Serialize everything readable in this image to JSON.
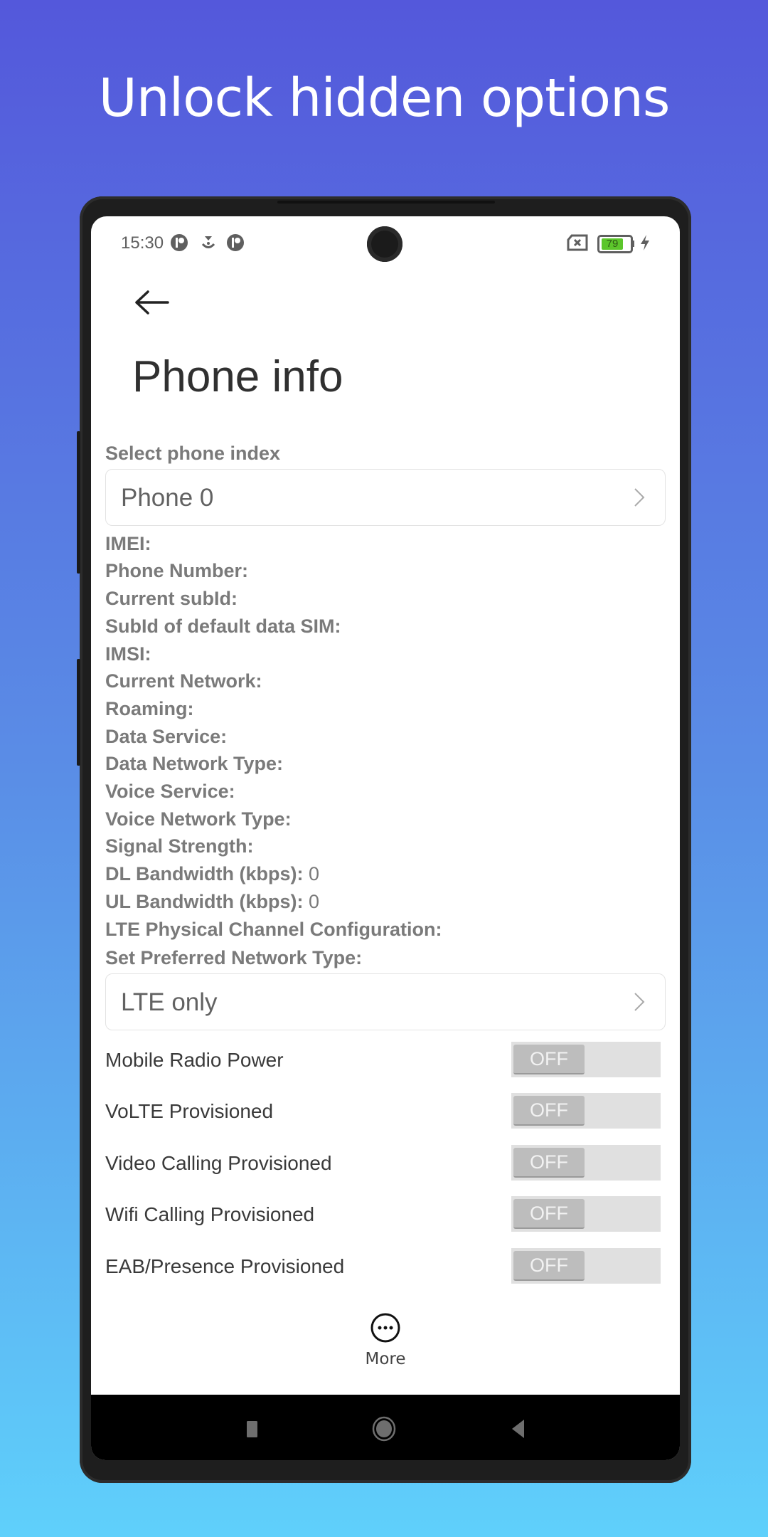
{
  "promo": {
    "headline": "Unlock hidden options"
  },
  "status_bar": {
    "time": "15:30",
    "left_icons": [
      "app-notification-icon",
      "download-icon",
      "app-notification-icon"
    ],
    "battery_level": "79",
    "battery_color": "#5cc62b",
    "right_icons": [
      "no-sim-icon",
      "battery-icon",
      "charging-icon"
    ]
  },
  "header": {
    "back": "back-arrow-icon",
    "title": "Phone info"
  },
  "phone_index": {
    "label": "Select phone index",
    "value": "Phone 0"
  },
  "info_fields": [
    {
      "label": "IMEI:",
      "value": ""
    },
    {
      "label": "Phone Number:",
      "value": ""
    },
    {
      "label": "Current subId:",
      "value": ""
    },
    {
      "label": "SubId of default data SIM:",
      "value": ""
    },
    {
      "label": "IMSI:",
      "value": ""
    },
    {
      "label": "Current Network:",
      "value": ""
    },
    {
      "label": "Roaming:",
      "value": ""
    },
    {
      "label": "Data Service:",
      "value": ""
    },
    {
      "label": "Data Network Type:",
      "value": ""
    },
    {
      "label": "Voice Service:",
      "value": ""
    },
    {
      "label": "Voice Network Type:",
      "value": ""
    },
    {
      "label": "Signal Strength:",
      "value": ""
    },
    {
      "label": "DL Bandwidth (kbps):",
      "value": "0"
    },
    {
      "label": "UL Bandwidth (kbps):",
      "value": "0"
    },
    {
      "label": "LTE Physical Channel Configuration:",
      "value": ""
    }
  ],
  "network_type": {
    "label": "Set Preferred Network Type:",
    "value": "LTE only"
  },
  "toggles": [
    {
      "label": "Mobile Radio Power",
      "state": "OFF"
    },
    {
      "label": "VoLTE Provisioned",
      "state": "OFF"
    },
    {
      "label": "Video Calling Provisioned",
      "state": "OFF"
    },
    {
      "label": "Wifi Calling Provisioned",
      "state": "OFF"
    },
    {
      "label": "EAB/Presence Provisioned",
      "state": "OFF"
    }
  ],
  "more": {
    "label": "More",
    "icon": "more-options-icon"
  },
  "nav_bar": {
    "buttons": [
      "recents",
      "home",
      "back"
    ]
  }
}
